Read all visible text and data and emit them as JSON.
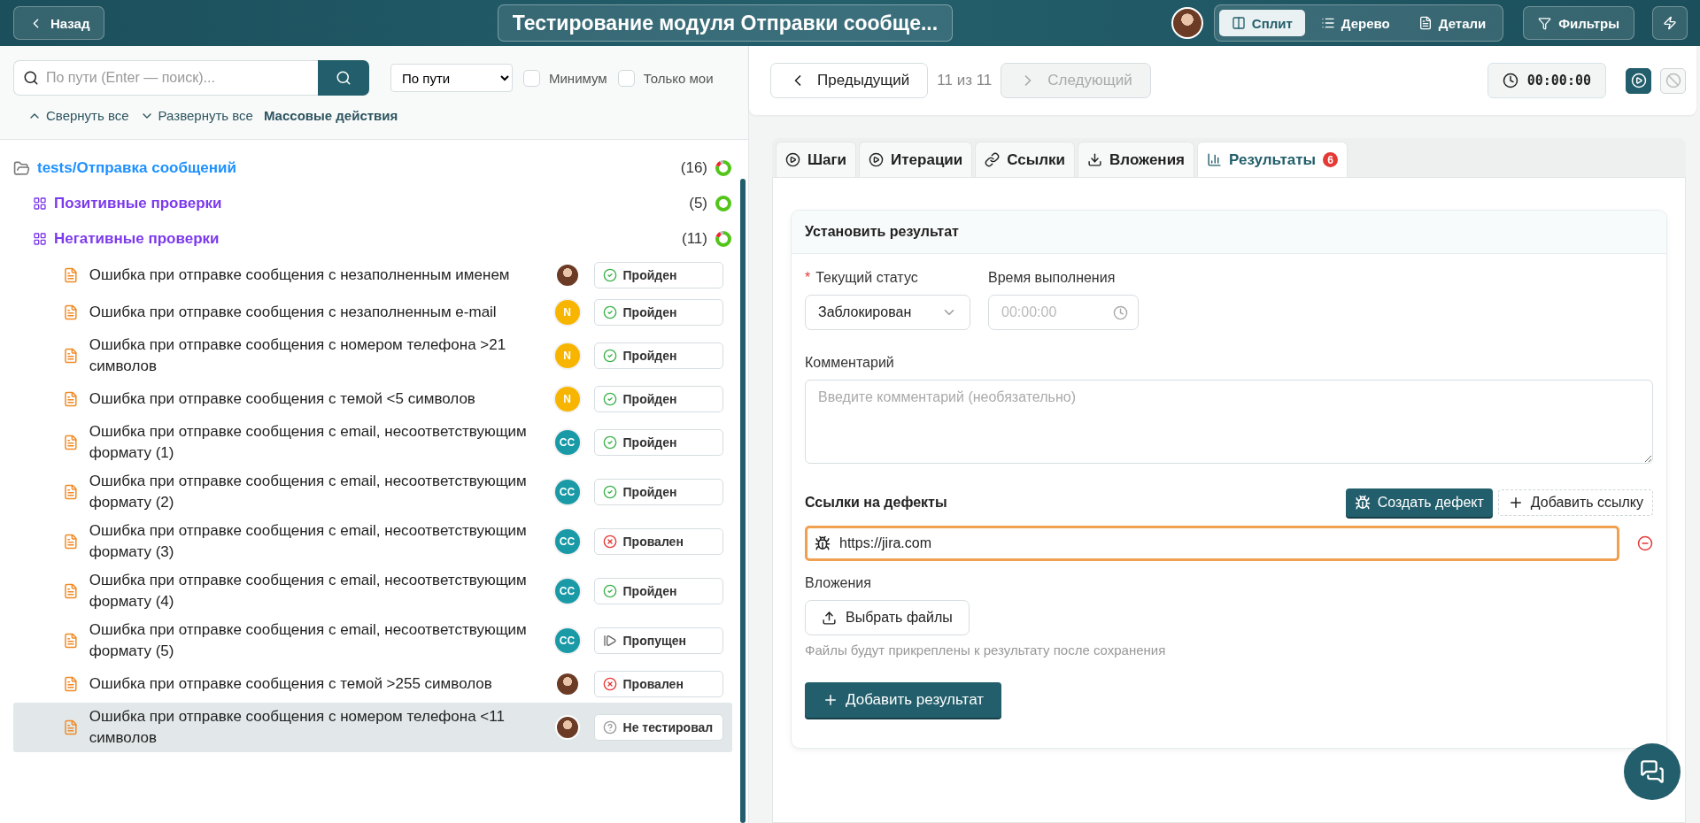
{
  "topbar": {
    "back": "Назад",
    "title": "Тестирование модуля Отправки сообще...",
    "views": [
      {
        "label": "Сплит",
        "kind": "split",
        "selected": true
      },
      {
        "label": "Дерево",
        "kind": "tree",
        "selected": false
      },
      {
        "label": "Детали",
        "kind": "details",
        "selected": false
      }
    ],
    "filters": "Фильтры"
  },
  "left": {
    "search": {
      "placeholder": "По пути (Enter — поиск)..."
    },
    "sort": "По пути",
    "checkboxes": [
      {
        "label": "Минимум",
        "checked": false
      },
      {
        "label": "Только мои",
        "checked": false
      }
    ],
    "actions": [
      {
        "label": "Свернуть все",
        "kind": "collapse"
      },
      {
        "label": "Развернуть все",
        "kind": "expand"
      },
      {
        "label": "Массовые действия",
        "kind": "bulk"
      }
    ]
  },
  "tree": {
    "label": "tests/Отправка сообщений",
    "count": "(16)",
    "all_passed": false,
    "children": [
      {
        "label": "Позитивные проверки",
        "count": "(5)",
        "all_passed": true
      },
      {
        "label": "Негативные проверки",
        "count": "(11)",
        "all_passed": false,
        "children": [
          {
            "title": "Ошибка при отправке сообщения с незаполненным именем",
            "assignee": {
              "kind": "photo"
            },
            "status": {
              "kind": "passed",
              "label": "Пройден"
            },
            "selected": false
          },
          {
            "title": "Ошибка при отправке сообщения с незаполненным e-mail",
            "assignee": {
              "kind": "initials",
              "initials": "N",
              "color": "#f7b500"
            },
            "status": {
              "kind": "passed",
              "label": "Пройден"
            },
            "selected": false
          },
          {
            "title": "Ошибка при отправке сообщения с номером телефона >21 символов",
            "assignee": {
              "kind": "initials",
              "initials": "N",
              "color": "#f7b500"
            },
            "status": {
              "kind": "passed",
              "label": "Пройден"
            },
            "selected": false
          },
          {
            "title": "Ошибка при отправке сообщения с темой <5 символов",
            "assignee": {
              "kind": "initials",
              "initials": "N",
              "color": "#f7b500"
            },
            "status": {
              "kind": "passed",
              "label": "Пройден"
            },
            "selected": false
          },
          {
            "title": "Ошибка при отправке сообщения с email, несоответствующим формату (1)",
            "assignee": {
              "kind": "initials",
              "initials": "CC",
              "color": "#1a9aa6"
            },
            "status": {
              "kind": "passed",
              "label": "Пройден"
            },
            "selected": false
          },
          {
            "title": "Ошибка при отправке сообщения с email, несоответствующим формату (2)",
            "assignee": {
              "kind": "initials",
              "initials": "CC",
              "color": "#1a9aa6"
            },
            "status": {
              "kind": "passed",
              "label": "Пройден"
            },
            "selected": false
          },
          {
            "title": "Ошибка при отправке сообщения с email, несоответствующим формату (3)",
            "assignee": {
              "kind": "initials",
              "initials": "CC",
              "color": "#1a9aa6"
            },
            "status": {
              "kind": "failed",
              "label": "Провален"
            },
            "selected": false
          },
          {
            "title": "Ошибка при отправке сообщения с email, несоответствующим формату (4)",
            "assignee": {
              "kind": "initials",
              "initials": "CC",
              "color": "#1a9aa6"
            },
            "status": {
              "kind": "passed",
              "label": "Пройден"
            },
            "selected": false
          },
          {
            "title": "Ошибка при отправке сообщения с email, несоответствующим формату (5)",
            "assignee": {
              "kind": "initials",
              "initials": "CC",
              "color": "#1a9aa6"
            },
            "status": {
              "kind": "skipped",
              "label": "Пропущен"
            },
            "selected": false
          },
          {
            "title": "Ошибка при отправке сообщения с темой >255 символов",
            "assignee": {
              "kind": "photo"
            },
            "status": {
              "kind": "failed",
              "label": "Провален"
            },
            "selected": false
          },
          {
            "title": "Ошибка при отправке сообщения с номером телефона <11 символов",
            "assignee": {
              "kind": "photo"
            },
            "status": {
              "kind": "untested",
              "label": "Не тестировал"
            },
            "selected": true
          }
        ]
      }
    ]
  },
  "nav": {
    "prev": "Предыдущий",
    "position": "11 из 11",
    "next": {
      "label": "Следующий",
      "disabled": true
    },
    "timer": "00:00:00"
  },
  "tabs": [
    {
      "label": "Шаги",
      "kind": "steps",
      "selected": false
    },
    {
      "label": "Итерации",
      "kind": "iterations",
      "selected": false
    },
    {
      "label": "Ссылки",
      "kind": "links",
      "selected": false
    },
    {
      "label": "Вложения",
      "kind": "attachments",
      "selected": false
    },
    {
      "label": "Результаты",
      "kind": "results",
      "selected": true,
      "badge": "6"
    }
  ],
  "form": {
    "title": "Установить результат",
    "required_mark": "*",
    "status_label": "Текущий статус",
    "status_value": "Заблокирован",
    "time_label": "Время выполнения",
    "time_placeholder": "00:00:00",
    "comment_label": "Комментарий",
    "comment_placeholder": "Введите комментарий (необязательно)",
    "defects_label": "Ссылки на дефекты",
    "create_defect": "Создать дефект",
    "add_link": "Добавить ссылку",
    "links": [
      {
        "url": "https://jira.com"
      }
    ],
    "attachments_label": "Вложения",
    "choose_files": "Выбрать файлы",
    "files_hint": "Файлы будут прикреплены к результату после сохранения",
    "add_result": "Добавить результат"
  }
}
